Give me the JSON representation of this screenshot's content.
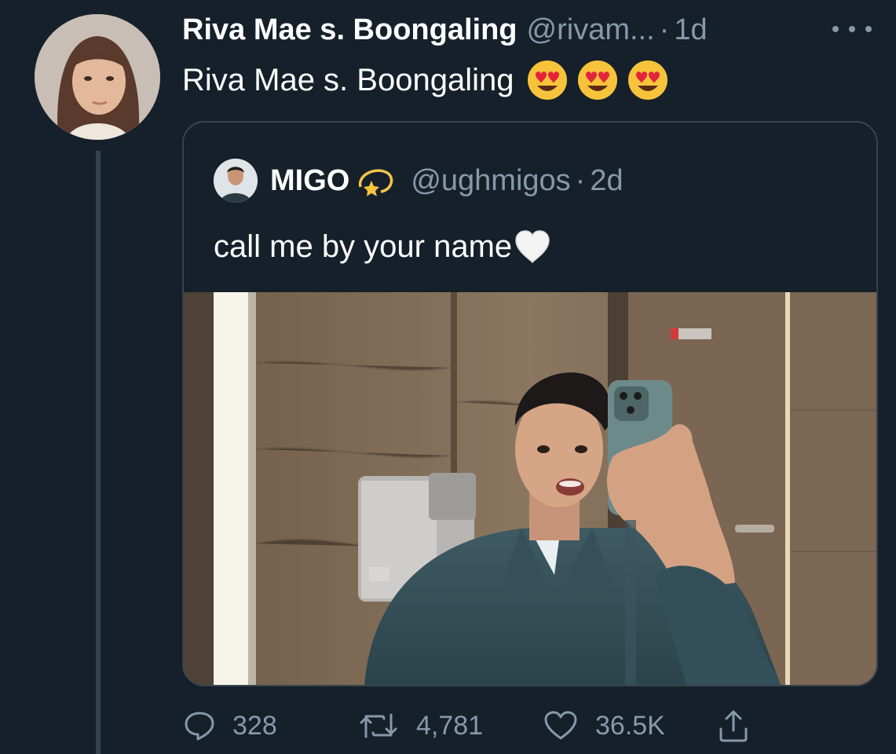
{
  "tweet": {
    "author": {
      "display_name": "Riva Mae s. Boongaling",
      "handle": "@rivam...",
      "time": "1d",
      "dot": "·"
    },
    "text": "Riva Mae s. Boongaling",
    "emojis": [
      "smiling-face-with-heart-eyes",
      "smiling-face-with-heart-eyes",
      "smiling-face-with-heart-eyes"
    ]
  },
  "quoted_tweet": {
    "author": {
      "display_name": "MIGO",
      "handle": "@ughmigos",
      "dot": "·",
      "time": "2d"
    },
    "text": "call me by your name",
    "emoji": "white-heart",
    "photo": "mirror-selfie-in-restroom"
  },
  "actions": {
    "replies": "328",
    "retweets": "4,781",
    "likes": "36.5K"
  },
  "colors": {
    "background": "#15202b",
    "muted_text": "#8899a6",
    "border": "#38444d",
    "text": "#ffffff"
  }
}
